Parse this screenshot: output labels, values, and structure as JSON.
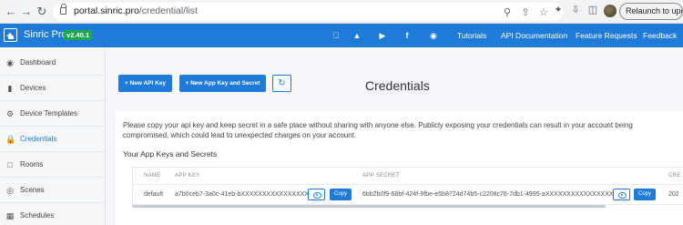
{
  "browser": {
    "url_host": "portal.sinric.pro",
    "url_path": "/credential/list",
    "relaunch_label": "Relaunch to update"
  },
  "app": {
    "brand": "Sinric Pro",
    "version": "v2.40.1",
    "accent_color": "#1e7bd7",
    "social_icons": [
      "apple-icon",
      "android-icon",
      "youtube-icon",
      "facebook-icon",
      "github-icon"
    ],
    "nav_links": [
      "Tutorials",
      "API Documentation",
      "Feature Requests",
      "Feedback"
    ]
  },
  "sidebar": {
    "items": [
      {
        "label": "Dashboard",
        "icon": "dashboard-icon",
        "active": false
      },
      {
        "label": "Devices",
        "icon": "devices-icon",
        "active": false
      },
      {
        "label": "Device Templates",
        "icon": "device-templates-icon",
        "active": false
      },
      {
        "label": "Credentials",
        "icon": "lock-icon",
        "active": true
      },
      {
        "label": "Rooms",
        "icon": "rooms-icon",
        "active": false
      },
      {
        "label": "Scenes",
        "icon": "scenes-icon",
        "active": false
      },
      {
        "label": "Schedules",
        "icon": "calendar-icon",
        "active": false
      }
    ]
  },
  "main": {
    "new_api_key_label": "+ New API Key",
    "new_app_key_label": "+ New App Key and Secret",
    "page_title": "Credentials",
    "notice": "Please copy your api key and keep secret in a safe place without sharing with anyone else. Publicly exposing your credentials can result in your account being compromised, which could lead to unexpected charges on your account.",
    "section_title": "Your App Keys and Secrets",
    "table": {
      "headers": [
        "NAME",
        "APP KEY",
        "APP SECRET",
        "CRE"
      ],
      "rows": [
        {
          "name": "default",
          "app_key": "a7b0ceb7-3a0c-41eb-bXXXXXXXXXXXXXXXX",
          "app_secret": "6bb2b0f9-68bf-424f-9fbe-e5b8724d74b5-c2208c76-7db1-4995-aXXXXXXXXXXXXXXXX",
          "created": "202",
          "copy_label": "Copy"
        }
      ]
    }
  }
}
